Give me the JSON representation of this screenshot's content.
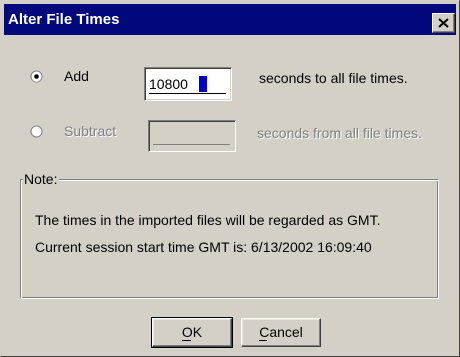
{
  "window": {
    "title": "Alter File Times",
    "close_icon": "close-icon"
  },
  "add": {
    "label": "Add",
    "selected": true,
    "value": "10800",
    "suffix": "seconds to all file times."
  },
  "subtract": {
    "label": "Subtract",
    "selected": false,
    "value": "",
    "suffix": "seconds from all file times.",
    "disabled": true
  },
  "note": {
    "legend": "Note:",
    "line1": "The times in the imported files will be regarded as GMT.",
    "line2": "Current session start time GMT is: 6/13/2002   16:09:40"
  },
  "buttons": {
    "ok": "OK",
    "cancel": "Cancel"
  },
  "colors": {
    "titlebar": "#00087b",
    "dialog_face": "#d4d0c8",
    "text_caret": "#0000cc"
  }
}
